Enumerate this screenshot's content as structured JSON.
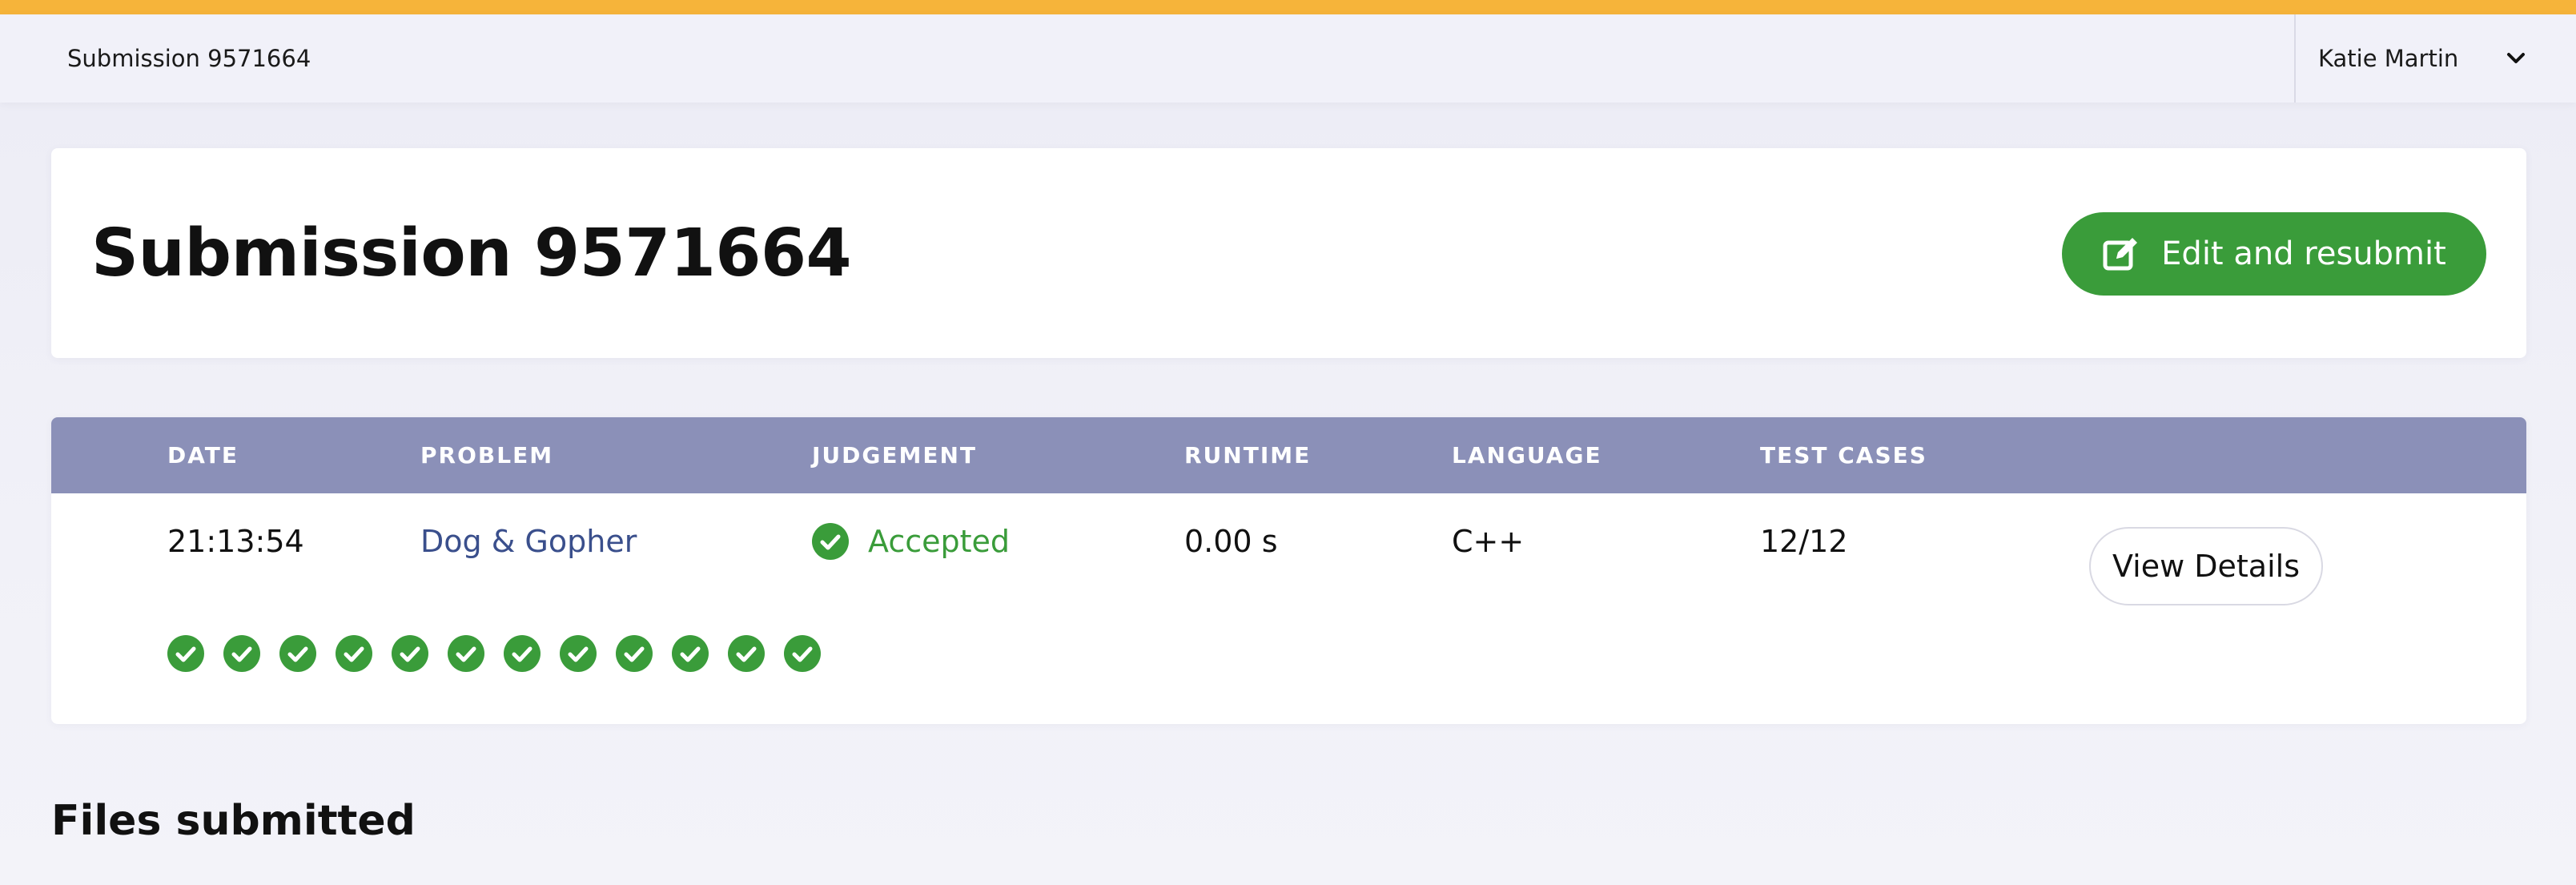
{
  "colors": {
    "accent_stripe": "#f6b43a",
    "success": "#3a9c3a",
    "table_header": "#8b90b8",
    "link": "#3a4f8c"
  },
  "topbar": {
    "breadcrumb": "Submission 9571664",
    "user_name": "Katie Martin",
    "user_menu_icon": "chevron-down-icon"
  },
  "header": {
    "title": "Submission 9571664",
    "resubmit_label": "Edit and resubmit",
    "resubmit_icon": "edit-icon"
  },
  "submission_table": {
    "columns": [
      "DATE",
      "PROBLEM",
      "JUDGEMENT",
      "RUNTIME",
      "LANGUAGE",
      "TEST CASES"
    ],
    "row": {
      "date": "21:13:54",
      "problem": "Dog & Gopher",
      "judgement": "Accepted",
      "runtime": "0.00 s",
      "language": "C++",
      "test_cases": "12/12",
      "details_label": "View Details"
    },
    "test_case_results": [
      "accepted",
      "accepted",
      "accepted",
      "accepted",
      "accepted",
      "accepted",
      "accepted",
      "accepted",
      "accepted",
      "accepted",
      "accepted",
      "accepted"
    ]
  },
  "files_section": {
    "heading": "Files submitted"
  }
}
